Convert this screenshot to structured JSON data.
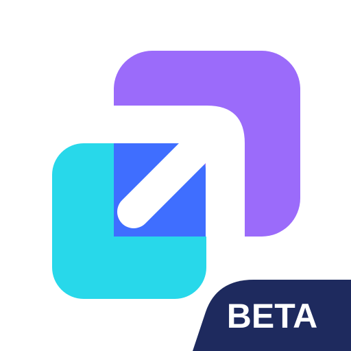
{
  "badge": {
    "label": "BETA"
  },
  "colors": {
    "background": "#ffffff",
    "purple_square": "#9B6BFA",
    "cyan_square": "#28D8EA",
    "overlap_blue": "#3F6EFF",
    "arrow": "#ffffff",
    "badge_background": "#1E2A5E",
    "badge_text": "#ffffff"
  },
  "icons": {
    "logo": "expand-arrow-logo-icon",
    "arrow": "diagonal-arrow-icon"
  }
}
